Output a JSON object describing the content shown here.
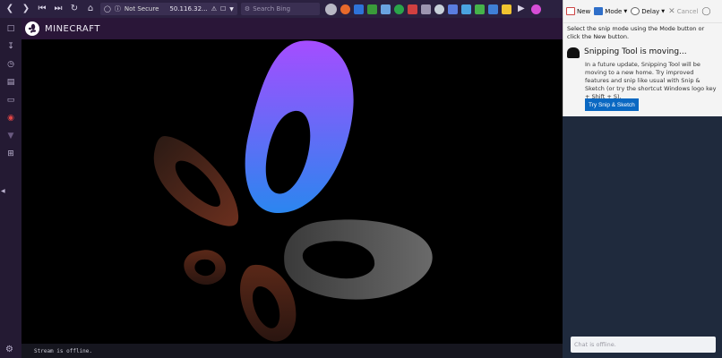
{
  "browser": {
    "security_label": "Not Secure",
    "url": "50.116.32...",
    "search_placeholder": "Search Bing",
    "accent_color": "#2b2140",
    "extension_colors": [
      "#e76a2b",
      "#2e73d9",
      "#3a9b3a",
      "#6aa3e0",
      "#2aa64a",
      "#d04040",
      "#b8b8c4",
      "#c7d0d9",
      "#5a7de0",
      "#4aa3e0",
      "#45b34a",
      "#3f7fd6",
      "#f0c330",
      "#d64dd6"
    ]
  },
  "sidebar": {
    "icons": [
      "bookmark-icon",
      "download-icon",
      "history-icon",
      "notes-icon",
      "tabs-icon",
      "vivaldi-icon",
      "wifi-icon",
      "add-panel-icon"
    ]
  },
  "page": {
    "brand": "MINECRAFT"
  },
  "stream": {
    "status": "Stream is offline."
  },
  "snipping_tool": {
    "new_label": "New",
    "mode_label": "Mode",
    "delay_label": "Delay",
    "cancel_label": "Cancel",
    "hint": "Select the snip mode using the Mode button or click the New button.",
    "notice_title": "Snipping Tool is moving...",
    "notice_body": "In a future update, Snipping Tool will be moving to a new home. Try improved features and snip like usual with Snip & Sketch (or try the shortcut Windows logo key + Shift + S).",
    "try_button": "Try Snip & Sketch"
  },
  "chat": {
    "placeholder": "Chat is offline."
  }
}
